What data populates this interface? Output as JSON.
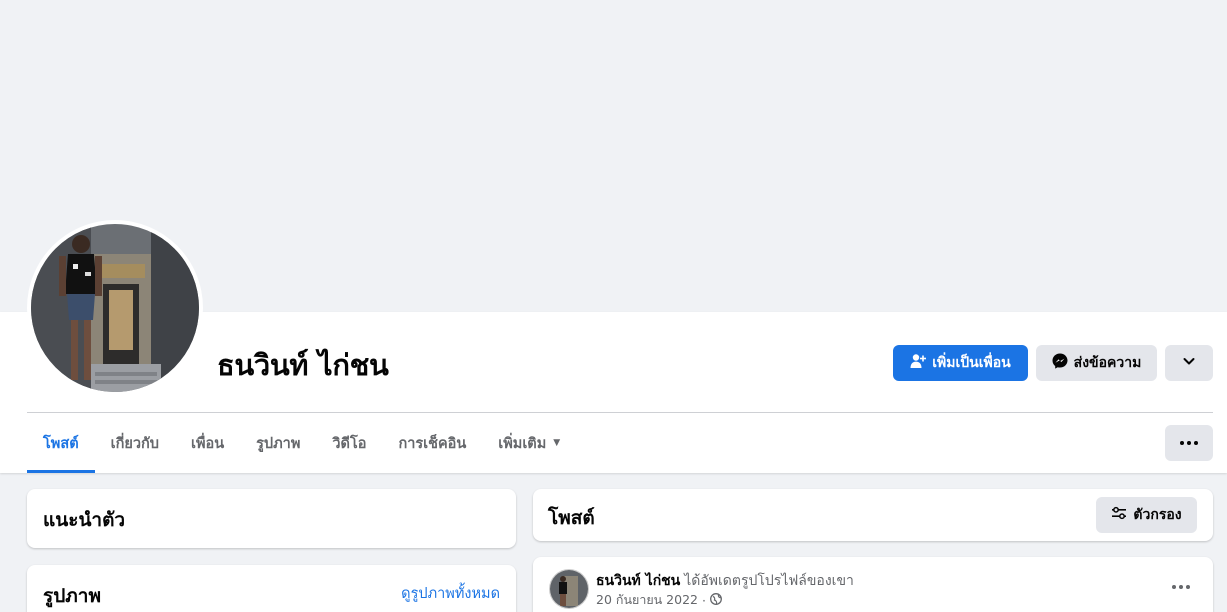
{
  "profile": {
    "name": "ธนวินท์ ไก่ชน"
  },
  "actions": {
    "add_friend": "เพิ่มเป็นเพื่อน",
    "message": "ส่งข้อความ",
    "more_icon": "chevron-down-icon"
  },
  "tabs": [
    {
      "label": "โพสต์",
      "active": true
    },
    {
      "label": "เกี่ยวกับ",
      "active": false
    },
    {
      "label": "เพื่อน",
      "active": false
    },
    {
      "label": "รูปภาพ",
      "active": false
    },
    {
      "label": "วิดีโอ",
      "active": false
    },
    {
      "label": "การเช็คอิน",
      "active": false
    },
    {
      "label": "เพิ่มเติม",
      "active": false
    }
  ],
  "intro": {
    "title": "แนะนำตัว"
  },
  "photos": {
    "title": "รูปภาพ",
    "see_all": "ดูรูปภาพทั้งหมด"
  },
  "posts": {
    "title": "โพสต์",
    "filter_label": "ตัวกรอง"
  },
  "post": {
    "author": "ธนวินท์ ไก่ชน",
    "action": "ได้อัพเดตรูปโปรไฟล์ของเขา",
    "date": "20 กันยายน 2022",
    "separator": "·",
    "privacy_icon": "globe-icon"
  },
  "colors": {
    "accent": "#1b74e4",
    "background": "#f0f2f5",
    "button_grey": "#e4e6eb"
  }
}
